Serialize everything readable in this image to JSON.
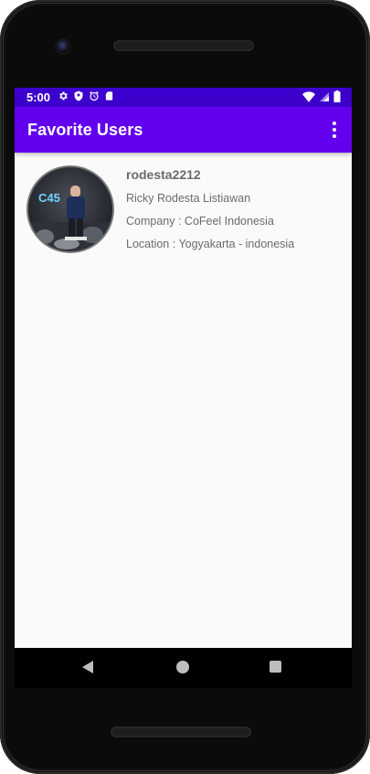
{
  "status_bar": {
    "time": "5:00",
    "left_icons": [
      "gear-icon",
      "shield-icon",
      "alarm-icon",
      "sd-card-icon"
    ],
    "right_icons": [
      "wifi-icon",
      "cell-signal-icon",
      "battery-icon"
    ]
  },
  "app_bar": {
    "title": "Favorite Users",
    "overflow_icon": "more-vert-icon",
    "background": "#6200ee",
    "status_background": "#3d00cc"
  },
  "favorites": [
    {
      "avatar": "user-photo",
      "username": "rodesta2212",
      "name": "Ricky Rodesta Listiawan",
      "company": "Company : CoFeel Indonesia",
      "location": "Location : Yogyakarta - indonesia"
    }
  ],
  "nav_bar": {
    "back_icon": "back-triangle-icon",
    "home_icon": "home-circle-icon",
    "recent_icon": "recents-square-icon"
  }
}
